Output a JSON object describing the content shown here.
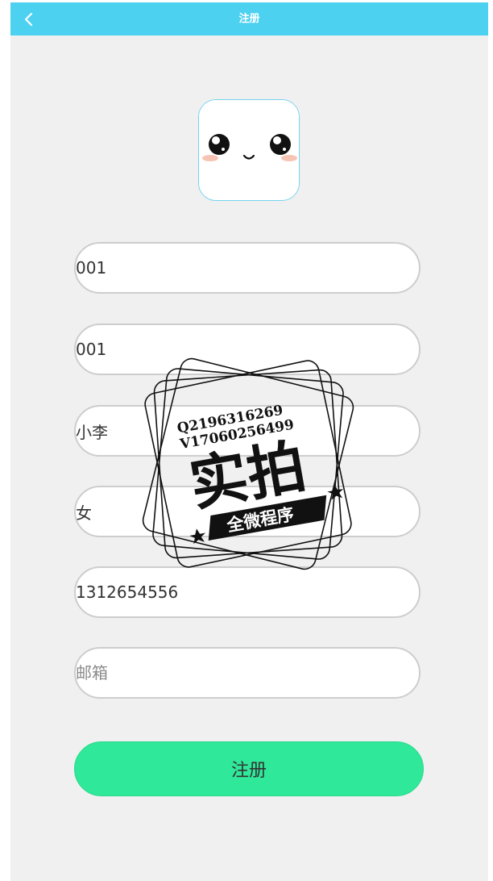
{
  "header": {
    "title": "注册",
    "back_icon": "chevron-left-icon",
    "background": "#4cd1f1"
  },
  "avatar": {
    "icon": "cute-face-icon"
  },
  "form": {
    "fields": [
      {
        "name": "username",
        "value": "001",
        "placeholder": ""
      },
      {
        "name": "password",
        "value": "001",
        "placeholder": ""
      },
      {
        "name": "realname",
        "value": "小李",
        "placeholder": ""
      },
      {
        "name": "gender",
        "value": "女",
        "placeholder": ""
      },
      {
        "name": "phone",
        "value": "1312654556",
        "placeholder": ""
      },
      {
        "name": "email",
        "value": "",
        "placeholder": "邮箱"
      }
    ],
    "submit_label": "注册",
    "submit_color": "#2fe89a"
  },
  "watermark": {
    "line1": "Q2196316269",
    "line2": "V17060256499",
    "main": "实拍",
    "banner": "全微程序"
  }
}
